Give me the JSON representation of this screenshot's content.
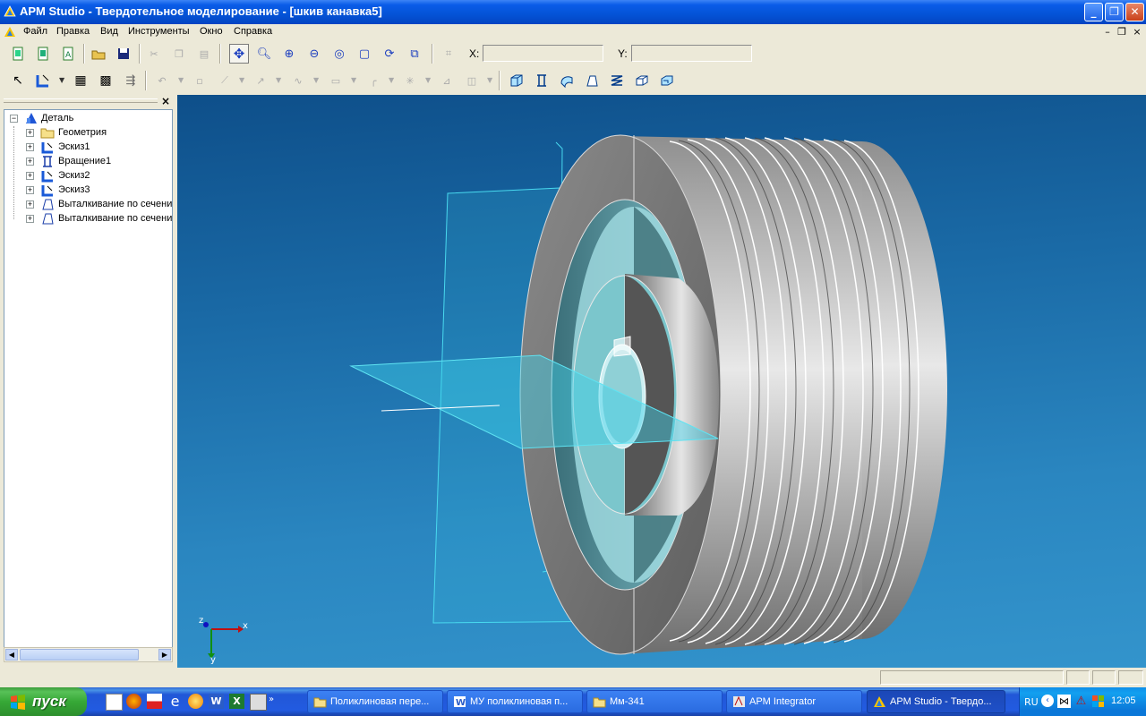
{
  "window": {
    "title": "APM Studio - Твердотельное моделирование - [шкив канавка5]",
    "buttons": [
      "minimize",
      "restore",
      "close"
    ]
  },
  "menu": {
    "items": [
      "Файл",
      "Правка",
      "Вид",
      "Инструменты",
      "Окно",
      "Справка"
    ]
  },
  "toolbar1": {
    "x_label": "X:",
    "y_label": "Y:",
    "x_value": "",
    "y_value": ""
  },
  "tree": {
    "root": "Деталь",
    "items": [
      {
        "label": "Геометрия",
        "icon": "folder-icon"
      },
      {
        "label": "Эскиз1",
        "icon": "sketch-icon"
      },
      {
        "label": "Вращение1",
        "icon": "revolve-icon"
      },
      {
        "label": "Эскиз2",
        "icon": "sketch-icon"
      },
      {
        "label": "Эскиз3",
        "icon": "sketch-icon"
      },
      {
        "label": "Выталкивание по сечени",
        "icon": "extrude-icon"
      },
      {
        "label": "Выталкивание по сечени",
        "icon": "extrude-icon"
      }
    ]
  },
  "panel": {
    "close_glyph": "×"
  },
  "axes": {
    "x": "x",
    "y": "y",
    "z": "z"
  },
  "taskbar": {
    "start_label": "пуск",
    "tasks": [
      {
        "label": "Поликлиновая пере...",
        "icon": "folder-icon",
        "active": false
      },
      {
        "label": "МУ поликлиновая п...",
        "icon": "word-icon",
        "active": false
      },
      {
        "label": "Мм-341",
        "icon": "folder-icon",
        "active": false
      },
      {
        "label": "APM Integrator",
        "icon": "apm-integrator-icon",
        "active": false
      },
      {
        "label": "APM Studio - Твердо...",
        "icon": "apm-studio-icon",
        "active": true
      }
    ],
    "tray": {
      "lang": "RU",
      "clock": "12:05"
    }
  },
  "colors": {
    "titlebar": "#0453d6",
    "viewport_top": "#0e4f8a",
    "viewport_bottom": "#3394cc",
    "plane": "#3fd0e8",
    "model": "#8c8c8c"
  }
}
